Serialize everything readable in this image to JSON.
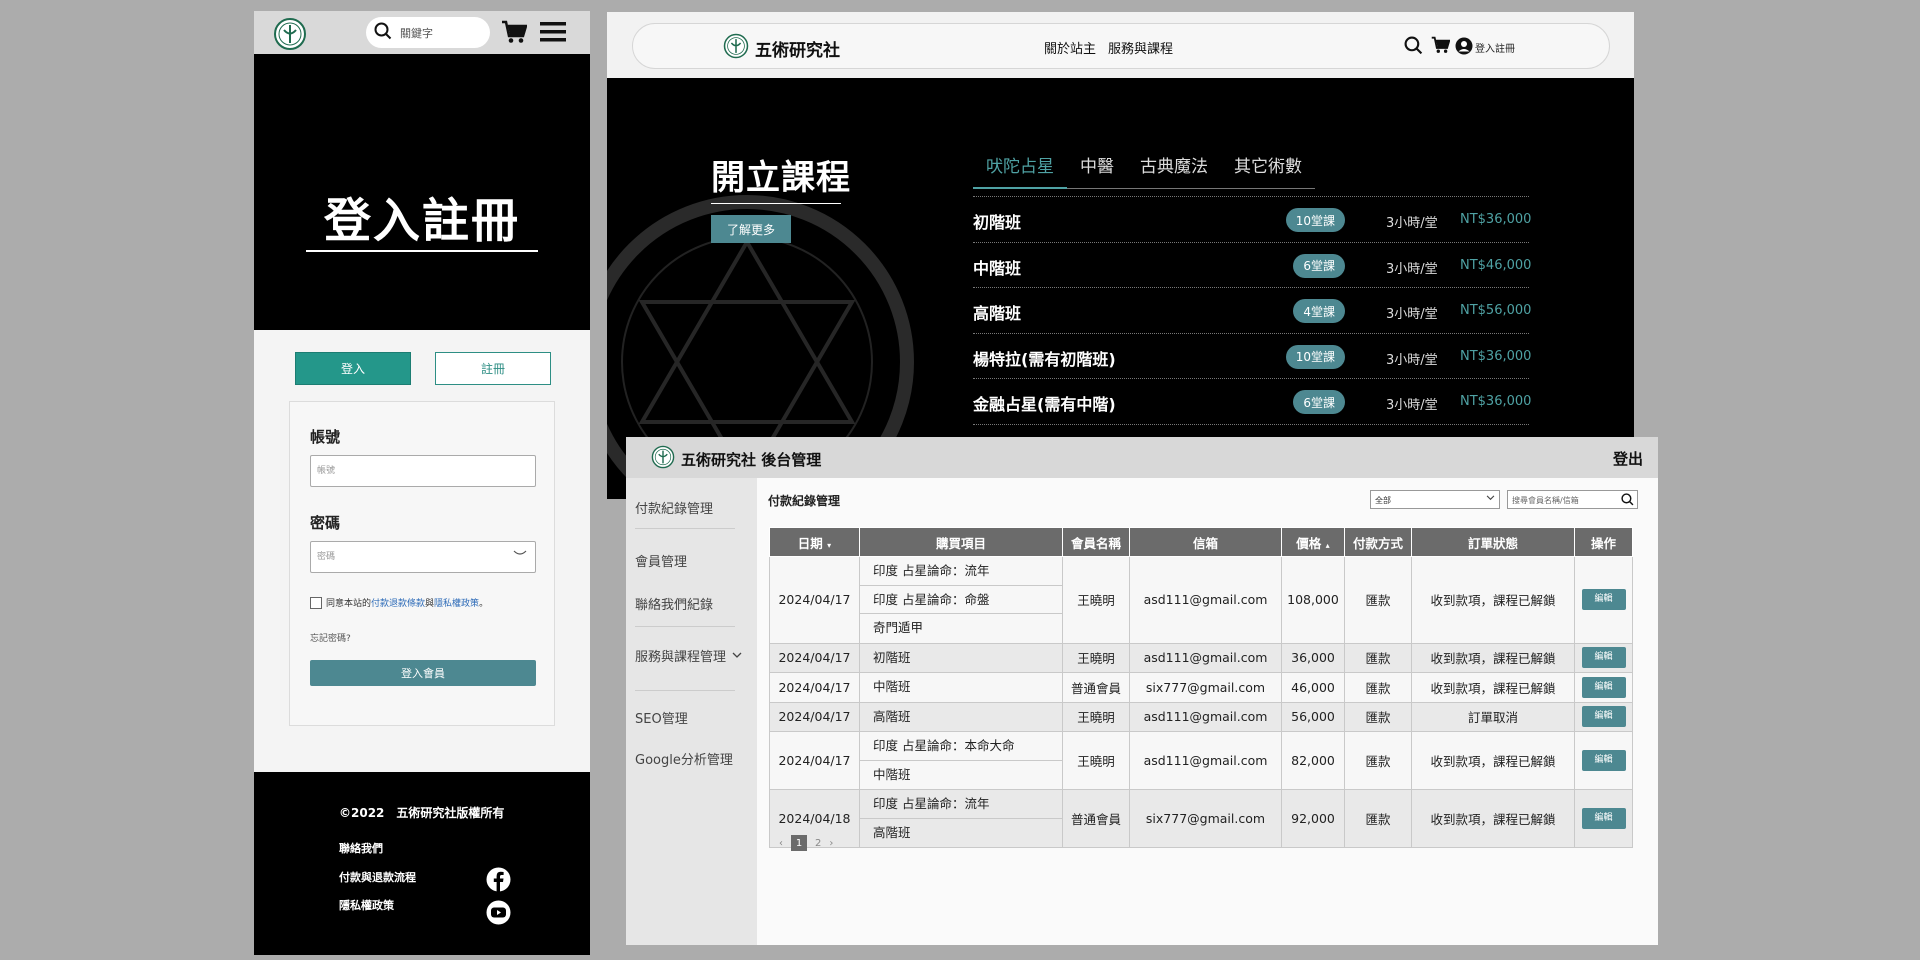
{
  "colors": {
    "teal": "#24978a",
    "slate_teal": "#4d8891",
    "accent_text": "#4fa2a4",
    "black": "#000000",
    "gray_bg": "#acacac"
  },
  "mobile": {
    "search_placeholder": "關鍵字",
    "hero_title": "登入註冊",
    "tab_login": "登入",
    "tab_register": "註冊",
    "account_label": "帳號",
    "account_placeholder": "帳號",
    "password_label": "密碼",
    "password_placeholder": "密碼",
    "agree_prefix": "同意本站的",
    "agree_link1": "付款退款條款",
    "agree_mid": "與",
    "agree_link2": "隱私權政策",
    "agree_suffix": "。",
    "forgot": "忘記密碼?",
    "submit": "登入會員",
    "footer": {
      "copyright": "©2022　五術研究社版權所有",
      "links": [
        "聯絡我們",
        "付款與退款流程",
        "隱私權政策"
      ]
    }
  },
  "desktop": {
    "brand": "五術研究社",
    "menu": [
      "關於站主",
      "服務與課程"
    ],
    "user_label": "登入註冊",
    "section_title": "開立課程",
    "more_button": "了解更多",
    "tabs": [
      "吠陀占星",
      "中醫",
      "古典魔法",
      "其它術數"
    ],
    "courses": [
      {
        "name": "初階班",
        "sessions": "10堂課",
        "duration": "3小時/堂",
        "price": "NT$36,000"
      },
      {
        "name": "中階班",
        "sessions": "6堂課",
        "duration": "3小時/堂",
        "price": "NT$46,000"
      },
      {
        "name": "高階班",
        "sessions": "4堂課",
        "duration": "3小時/堂",
        "price": "NT$56,000"
      },
      {
        "name": "楊特拉(需有初階班)",
        "sessions": "10堂課",
        "duration": "3小時/堂",
        "price": "NT$36,000"
      },
      {
        "name": "金融占星(需有中階)",
        "sessions": "6堂課",
        "duration": "3小時/堂",
        "price": "NT$36,000"
      }
    ]
  },
  "admin": {
    "brand": "五術研究社 後台管理",
    "logout": "登出",
    "sidebar": [
      "付款紀錄管理",
      "會員管理",
      "聯絡我們紀錄",
      "服務與課程管理",
      "SEO管理",
      "Google分析管理"
    ],
    "page_title": "付款紀錄管理",
    "filter_value": "全部",
    "search_placeholder": "搜尋會員名稱/信箱",
    "columns": [
      "日期",
      "購買項目",
      "會員名稱",
      "信箱",
      "價格",
      "付款方式",
      "訂單狀態",
      "操作"
    ],
    "rows": [
      {
        "date": "2024/04/17",
        "items": [
          "印度 占星論命：流年",
          "印度 占星論命：命盤",
          "奇門遁甲"
        ],
        "member": "王曉明",
        "email": "asd111@gmail.com",
        "price": "108,000",
        "method": "匯款",
        "status": "收到款項，課程已解鎖",
        "action": "編輯"
      },
      {
        "date": "2024/04/17",
        "items": [
          "初階班"
        ],
        "member": "王曉明",
        "email": "asd111@gmail.com",
        "price": "36,000",
        "method": "匯款",
        "status": "收到款項，課程已解鎖",
        "action": "編輯"
      },
      {
        "date": "2024/04/17",
        "items": [
          "中階班"
        ],
        "member": "普通會員",
        "email": "six777@gmail.com",
        "price": "46,000",
        "method": "匯款",
        "status": "收到款項，課程已解鎖",
        "action": "編輯"
      },
      {
        "date": "2024/04/17",
        "items": [
          "高階班"
        ],
        "member": "王曉明",
        "email": "asd111@gmail.com",
        "price": "56,000",
        "method": "匯款",
        "status": "訂單取消",
        "action": "編輯"
      },
      {
        "date": "2024/04/17",
        "items": [
          "印度 占星論命：本命大命",
          "中階班"
        ],
        "member": "王曉明",
        "email": "asd111@gmail.com",
        "price": "82,000",
        "method": "匯款",
        "status": "收到款項，課程已解鎖",
        "action": "編輯"
      },
      {
        "date": "2024/04/18",
        "items": [
          "印度 占星論命：流年",
          "高階班"
        ],
        "member": "普通會員",
        "email": "six777@gmail.com",
        "price": "92,000",
        "method": "匯款",
        "status": "收到款項，課程已解鎖",
        "action": "編輯"
      }
    ],
    "pager": {
      "prev": "‹",
      "pages": [
        "1",
        "2"
      ],
      "current": "1",
      "next": "›"
    }
  }
}
